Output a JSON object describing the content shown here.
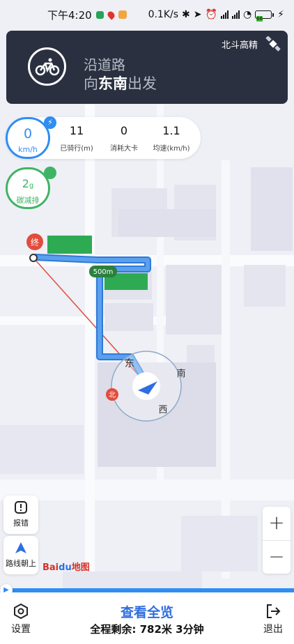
{
  "status_bar": {
    "time": "下午4:20",
    "net_speed": "0.1K/s",
    "battery": "66"
  },
  "navigation": {
    "road": "沿道路",
    "dir_prefix": "向",
    "dir_highlight": "东南",
    "dir_suffix": "出发",
    "gps_label": "北斗高精",
    "icon": "bicycle-icon"
  },
  "stats": {
    "speed_value": "0",
    "speed_unit": "km/h",
    "distance_value": "11",
    "distance_label": "已骑行(m)",
    "calories_value": "0",
    "calories_label": "消耗大卡",
    "avg_speed_value": "1.1",
    "avg_speed_label": "均速(km/h)",
    "carbon_value": "2",
    "carbon_unit": "g",
    "carbon_label": "碳减排"
  },
  "map": {
    "end_marker": "终",
    "distance_badge": "500m",
    "compass_north": "北",
    "compass_east": "东",
    "compass_south": "南",
    "compass_west": "西",
    "brand_bai": "Bai",
    "brand_du": "du",
    "brand_map": "地图",
    "colors": {
      "route": "#4a90e2",
      "route_light": "#9cc6f4",
      "water": "#cfe0f5"
    }
  },
  "side_buttons": {
    "report_label": "报错",
    "route_up_label": "路线朝上"
  },
  "zoom": {
    "in": "+",
    "out": "−"
  },
  "bottom_bar": {
    "settings_label": "设置",
    "overview_label": "查看全览",
    "remaining": "全程剩余: 782米 3分钟",
    "exit_label": "退出"
  }
}
